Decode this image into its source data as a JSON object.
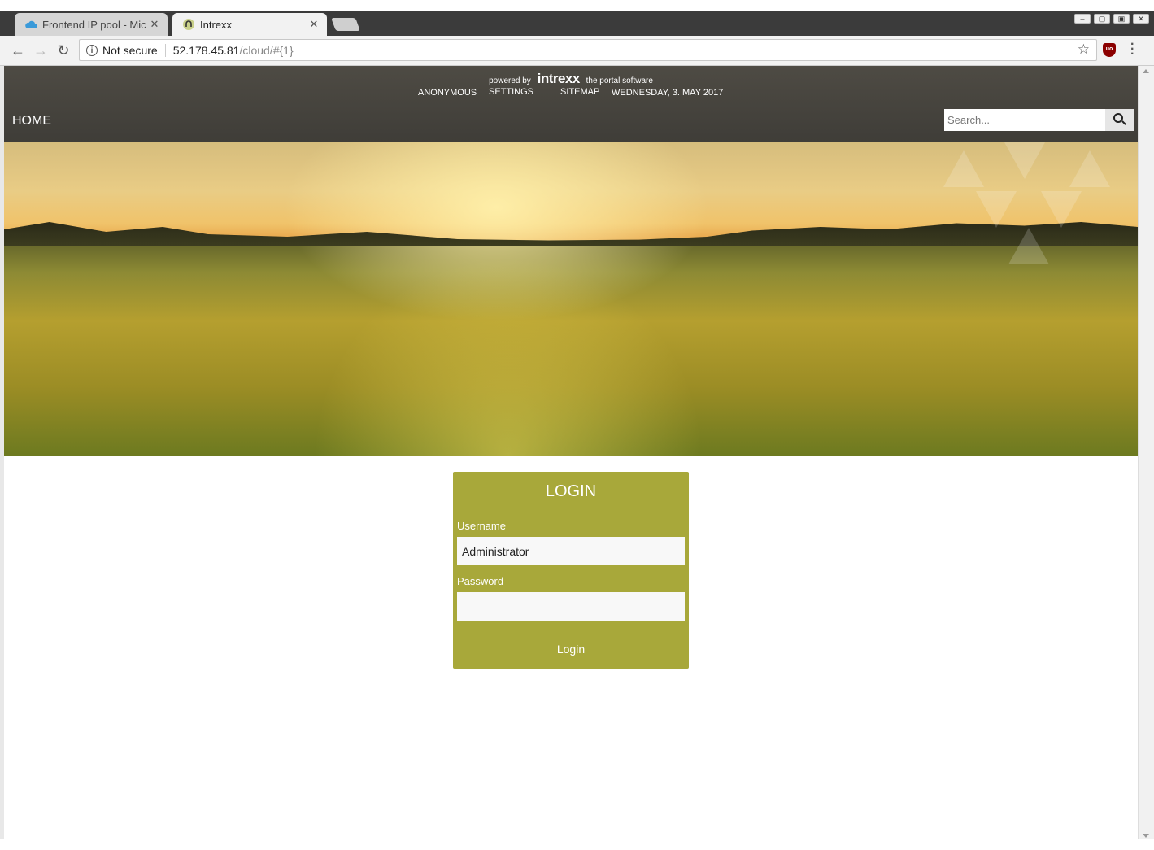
{
  "browser": {
    "tabs": [
      {
        "title": "Frontend IP pool - Mic",
        "icon": "cloud-icon",
        "active": false
      },
      {
        "title": "Intrexx",
        "icon": "intrexx-favicon-icon",
        "active": true
      }
    ],
    "security_label": "Not secure",
    "url_host": "52.178.45.81",
    "url_path": "/cloud/#{1}",
    "extension_badge": "uo"
  },
  "portal": {
    "powered_by": "powered by",
    "brand": "intrexx",
    "tagline": "the portal software",
    "top_links": {
      "user": "ANONYMOUS",
      "settings": "SETTINGS",
      "sitemap": "SITEMAP",
      "date": "WEDNESDAY, 3. MAY 2017"
    },
    "home_label": "HOME",
    "search_placeholder": "Search..."
  },
  "login": {
    "title": "LOGIN",
    "username_label": "Username",
    "username_value": "Administrator",
    "password_label": "Password",
    "password_value": "",
    "button_label": "Login"
  },
  "colors": {
    "header_bg": "#46443e",
    "login_panel": "#a8a83a"
  }
}
